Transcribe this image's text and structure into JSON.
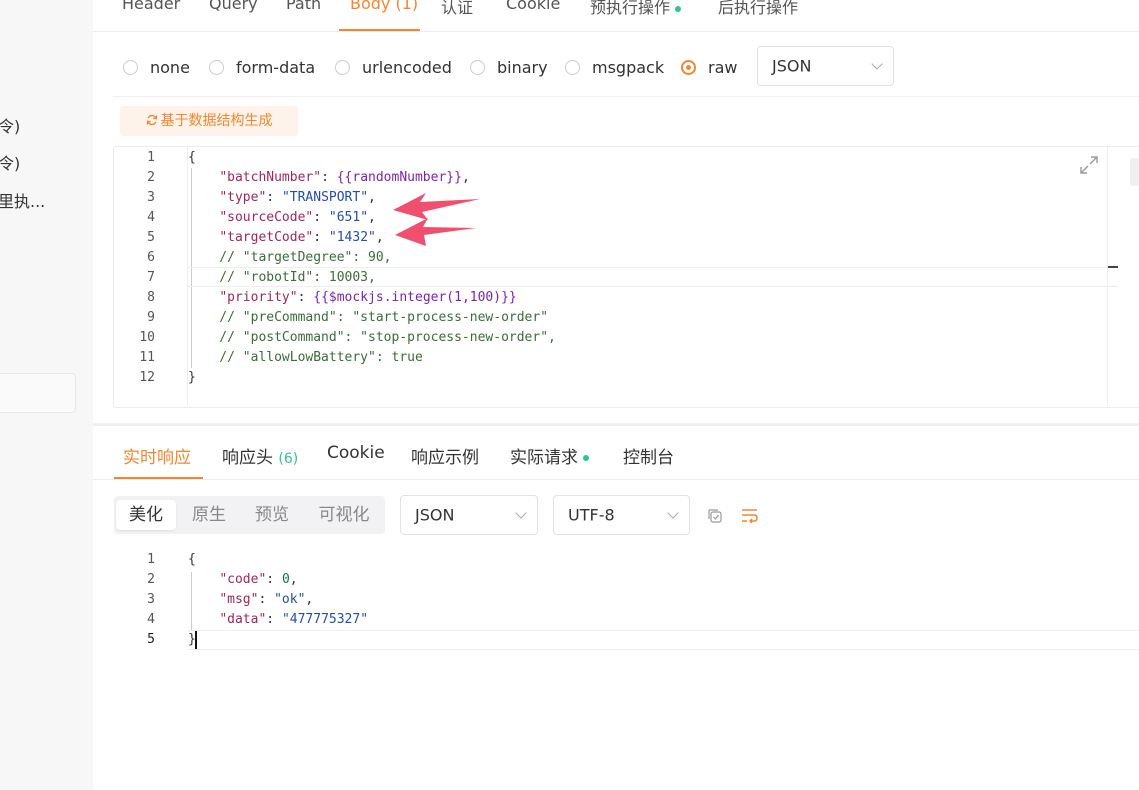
{
  "sidebar": {
    "items": [
      {
        "label": "令)"
      },
      {
        "label": "令)"
      },
      {
        "label": "里执..."
      }
    ]
  },
  "request_tabs": [
    {
      "label": "Header"
    },
    {
      "label": "Query"
    },
    {
      "label": "Path"
    },
    {
      "label": "Body",
      "count": "(1)"
    },
    {
      "label": "认证"
    },
    {
      "label": "Cookie"
    },
    {
      "label": "预执行操作"
    },
    {
      "label": "后执行操作"
    }
  ],
  "body_types": [
    "none",
    "form-data",
    "urlencoded",
    "binary",
    "msgpack",
    "raw"
  ],
  "body_type_selected": "raw",
  "raw_format": "JSON",
  "generate_button": "基于数据结构生成",
  "request_body_lines": [
    "{",
    "    \"batchNumber\": {{randomNumber}},",
    "    \"type\": \"TRANSPORT\",",
    "    \"sourceCode\": \"651\",",
    "    \"targetCode\": \"1432\",",
    "    // \"targetDegree\": 90,",
    "    // \"robotId\": 10003,",
    "    \"priority\": {{$mockjs.integer(1,100)}}",
    "    // \"preCommand\": \"start-process-new-order\"",
    "    // \"postCommand\": \"stop-process-new-order\",",
    "    // \"allowLowBattery\": true",
    "}"
  ],
  "response_tabs": [
    {
      "label": "实时响应"
    },
    {
      "label": "响应头",
      "count": "(6)"
    },
    {
      "label": "Cookie"
    },
    {
      "label": "响应示例"
    },
    {
      "label": "实际请求"
    },
    {
      "label": "控制台"
    }
  ],
  "view_modes": [
    "美化",
    "原生",
    "预览",
    "可视化"
  ],
  "view_mode_selected": "美化",
  "response_format": "JSON",
  "response_encoding": "UTF-8",
  "response_body_lines": [
    "{",
    "    \"code\": 0,",
    "    \"msg\": \"ok\",",
    "    \"data\": \"477775327\"",
    "}"
  ],
  "colors": {
    "accent": "#f5862e",
    "status_dot": "#31c48d",
    "annotation_arrow": "#f0506e"
  }
}
